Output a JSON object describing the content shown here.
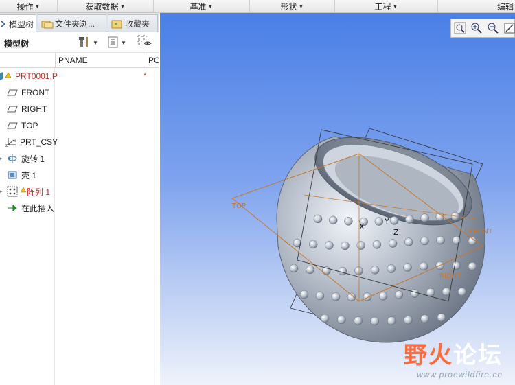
{
  "menubar": {
    "items": [
      {
        "label": "操作"
      },
      {
        "label": "获取数据"
      },
      {
        "label": "基准"
      },
      {
        "label": "形状"
      },
      {
        "label": "工程"
      },
      {
        "label": "编辑"
      }
    ]
  },
  "tabs": [
    {
      "label": "模型树",
      "active": true
    },
    {
      "label": "文件夹浏...",
      "active": false
    },
    {
      "label": "收藏夹",
      "active": false
    }
  ],
  "model_tree": {
    "title": "模型树",
    "columns": [
      "PNAME",
      "PC"
    ],
    "rows": [
      {
        "label": "PRT0001.P",
        "mark": "*",
        "icon": "part-icon",
        "red": true
      },
      {
        "label": "FRONT",
        "icon": "datum-plane-icon",
        "red": false
      },
      {
        "label": "RIGHT",
        "icon": "datum-plane-icon",
        "red": false
      },
      {
        "label": "TOP",
        "icon": "datum-plane-icon",
        "red": false
      },
      {
        "label": "PRT_CSY",
        "icon": "csys-icon",
        "red": false
      },
      {
        "label": "旋转 1",
        "icon": "revolve-icon",
        "red": false
      },
      {
        "label": "壳 1",
        "icon": "shell-icon",
        "red": false
      },
      {
        "label": "阵列 1",
        "icon": "pattern-icon",
        "red": true
      },
      {
        "label": "在此插入",
        "icon": "insert-arrow-icon",
        "red": false
      }
    ]
  },
  "viewport": {
    "toolbar_icons": [
      "zoom-fit-icon",
      "zoom-in-icon",
      "zoom-out-icon",
      "repaint-icon"
    ],
    "plane_labels": {
      "top": "TOP",
      "front": "FRONT",
      "right": "RIGHT"
    },
    "axis_labels": {
      "x": "X",
      "y": "Y",
      "z": "Z"
    },
    "watermark_title_a": "野火",
    "watermark_title_b": "论坛",
    "watermark_url": "www.proewildfire.cn"
  }
}
